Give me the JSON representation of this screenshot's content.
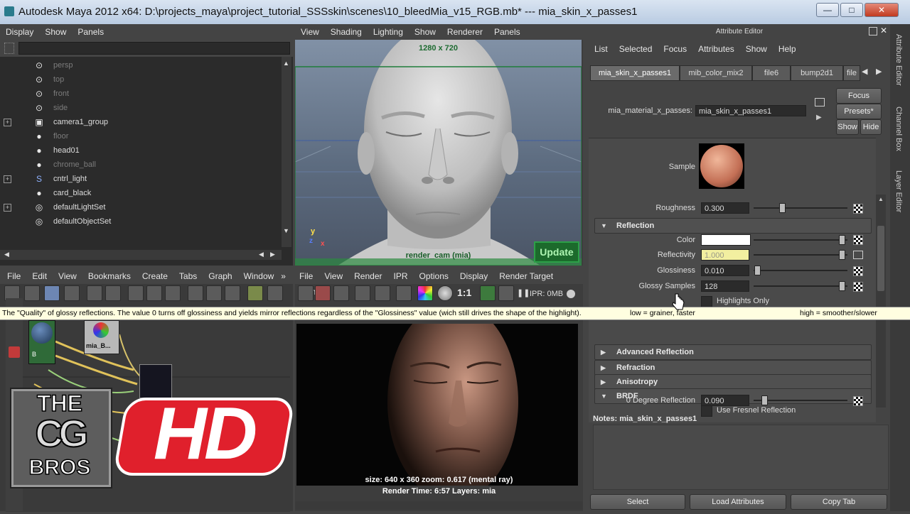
{
  "window": {
    "title": "Autodesk Maya 2012 x64: D:\\projects_maya\\project_tutorial_SSSskin\\scenes\\10_bleedMia_v15_RGB.mb*   ---   mia_skin_x_passes1"
  },
  "outliner": {
    "menu": [
      "Display",
      "Show",
      "Panels"
    ],
    "items": [
      {
        "label": "persp",
        "dim": true,
        "icon": "camera-icon",
        "expand": false
      },
      {
        "label": "top",
        "dim": true,
        "icon": "camera-icon",
        "expand": false
      },
      {
        "label": "front",
        "dim": true,
        "icon": "camera-icon",
        "expand": false
      },
      {
        "label": "side",
        "dim": true,
        "icon": "camera-icon",
        "expand": false
      },
      {
        "label": "camera1_group",
        "dim": false,
        "icon": "group-icon",
        "expand": true
      },
      {
        "label": "floor",
        "dim": true,
        "icon": "mesh-icon",
        "expand": false
      },
      {
        "label": "head01",
        "dim": false,
        "icon": "mesh-icon",
        "expand": false
      },
      {
        "label": "chrome_ball",
        "dim": true,
        "icon": "mesh-icon",
        "expand": false
      },
      {
        "label": "cntrl_light",
        "dim": false,
        "icon": "curve-icon",
        "expand": true
      },
      {
        "label": "card_black",
        "dim": false,
        "icon": "mesh-icon",
        "expand": false
      },
      {
        "label": "defaultLightSet",
        "dim": false,
        "icon": "set-icon",
        "expand": true
      },
      {
        "label": "defaultObjectSet",
        "dim": false,
        "icon": "set-icon",
        "expand": false
      }
    ]
  },
  "viewport": {
    "menu": [
      "View",
      "Shading",
      "Lighting",
      "Show",
      "Renderer",
      "Panels"
    ],
    "resolution_label": "1280 x 720",
    "camera_label": "render_cam (mia)",
    "update_button": "Update",
    "axis_y": "y",
    "axis_z": "z",
    "axis_x": "x"
  },
  "hypershade": {
    "menu": [
      "File",
      "Edit",
      "View",
      "Bookmarks",
      "Create",
      "Tabs",
      "Graph",
      "Window"
    ],
    "overflow": "»",
    "node_label": "mia_B...",
    "node_b": "B"
  },
  "renderview": {
    "menu": [
      "File",
      "View",
      "Render",
      "IPR",
      "Options",
      "Display",
      "Render Target",
      "Panels"
    ],
    "ratio_label": "1:1",
    "ipr_label": "IPR: 0MB",
    "info_line1": "size: 640 x 360  zoom: 0.617      (mental ray)",
    "info_line2": "Render Time: 6:57       Layers: mia"
  },
  "attribute_editor": {
    "panel_title": "Attribute Editor",
    "menu": [
      "List",
      "Selected",
      "Focus",
      "Attributes",
      "Show",
      "Help"
    ],
    "tabs": [
      "mia_skin_x_passes1",
      "mib_color_mix2",
      "file6",
      "bump2d1",
      "file"
    ],
    "material_label": "mia_material_x_passes:",
    "material_value": "mia_skin_x_passes1",
    "focus_button": "Focus",
    "presets_button": "Presets*",
    "show_button": "Show",
    "hide_button": "Hide",
    "sample_label": "Sample",
    "roughness": {
      "label": "Roughness",
      "value": "0.300",
      "level": 0.3
    },
    "reflection_section": "Reflection",
    "color_label": "Color",
    "reflectivity": {
      "label": "Reflectivity",
      "value": "1.000",
      "level": 1.0
    },
    "glossiness": {
      "label": "Glossiness",
      "value": "0.010",
      "level": 0.01
    },
    "glossy_samples": {
      "label": "Glossy Samples",
      "value": "128",
      "level": 1.0
    },
    "highlights_only": "Highlights Only",
    "advanced_reflection": "Advanced Reflection",
    "refraction": "Refraction",
    "anisotropy": "Anisotropy",
    "brdf": "BRDF",
    "use_fresnel": "Use Fresnel Reflection",
    "zero_degree": {
      "label": "0 Degree Reflection",
      "value": "0.090",
      "level": 0.09
    },
    "notes_label": "Notes:  mia_skin_x_passes1",
    "select_button": "Select",
    "load_button": "Load Attributes",
    "copy_button": "Copy Tab"
  },
  "side_tabs": [
    "Attribute Editor",
    "Channel Box",
    "Layer Editor"
  ],
  "tooltip": {
    "text": "The \"Quality\" of glossy reflections. The value 0 turns off glossiness and yields mirror reflections regardless of the \"Glossiness\" value (wich still drives the shape of the highlight).",
    "low": "low = grainer, faster",
    "high": "high = smoother/slower"
  },
  "watermark": {
    "the": "THE",
    "cg": "CG",
    "bros": "BROS",
    "hd": "HD"
  },
  "colors": {
    "reflectivity_field": "#f2efa0",
    "color_swatch": "#ffffff",
    "hd_red": "#e0202c"
  }
}
